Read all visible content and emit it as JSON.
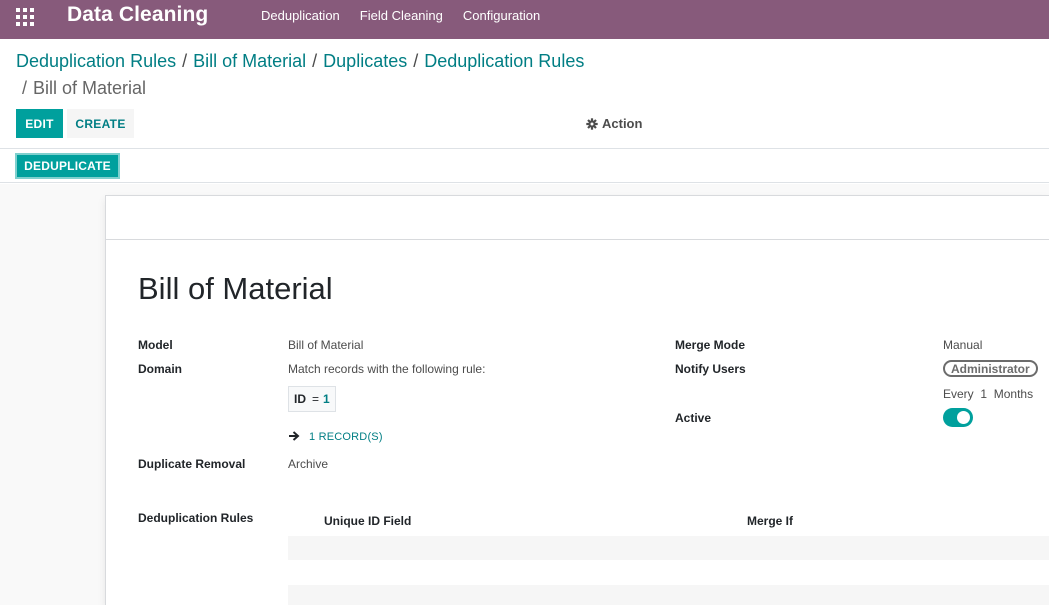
{
  "navbar": {
    "app_title": "Data Cleaning",
    "menu": [
      "Deduplication",
      "Field Cleaning",
      "Configuration"
    ],
    "color": "#875a7b"
  },
  "breadcrumb": {
    "items": [
      "Deduplication Rules",
      "Bill of Material",
      "Duplicates",
      "Deduplication Rules"
    ],
    "current": "Bill of Material",
    "separator": "/"
  },
  "control_panel": {
    "edit_label": "EDIT",
    "create_label": "CREATE",
    "action_label": "Action"
  },
  "statusbar": {
    "deduplicate_label": "DEDUPLICATE"
  },
  "form": {
    "title": "Bill of Material",
    "model_label": "Model",
    "model_value": "Bill of Material",
    "domain_label": "Domain",
    "domain_text": "Match records with the following rule:",
    "domain_rule": {
      "field": "ID",
      "operator": "=",
      "value": "1"
    },
    "records_link": "1 RECORD(S)",
    "duplicate_removal_label": "Duplicate Removal",
    "duplicate_removal_value": "Archive",
    "merge_mode_label": "Merge Mode",
    "merge_mode_value": "Manual",
    "notify_users_label": "Notify Users",
    "notify_user_tag": "Administrator",
    "notify_every": "Every",
    "notify_interval": "1",
    "notify_unit": "Months",
    "active_label": "Active",
    "active": true,
    "dedup_rules_label": "Deduplication Rules",
    "rules_columns": [
      "Unique ID Field",
      "Merge If"
    ]
  },
  "colors": {
    "primary": "#00a09d",
    "link": "#017e84"
  }
}
